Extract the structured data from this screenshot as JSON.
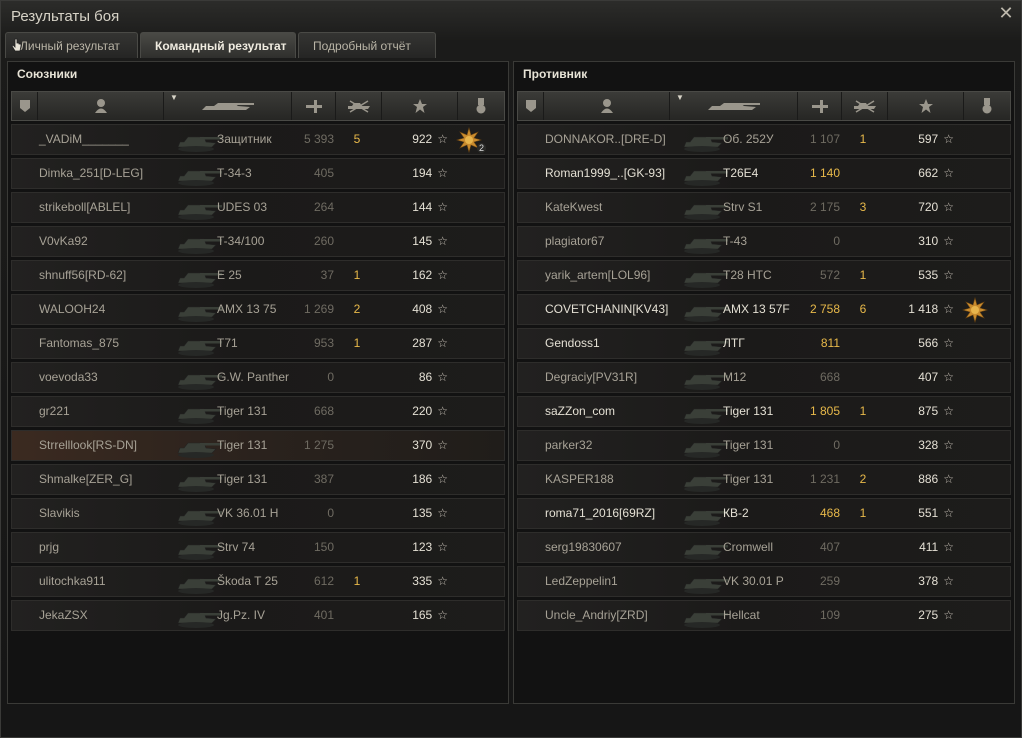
{
  "window": {
    "title": "Результаты боя"
  },
  "tabs": [
    {
      "label": "Личный результат",
      "active": false
    },
    {
      "label": "Командный результат",
      "active": true
    },
    {
      "label": "Подробный отчёт",
      "active": false
    }
  ],
  "allies": {
    "title": "Союзники",
    "players": [
      {
        "name": "_VADiM_______",
        "vehicle": "Защитник",
        "damage": "5 393",
        "kills": "5",
        "xp": "922",
        "alive": false,
        "damage_highlight": false,
        "medal": "hero-medal",
        "medal_count": "2",
        "highlight": false
      },
      {
        "name": "Dimka_251[D-LEG]",
        "vehicle": "T-34-3",
        "damage": "405",
        "kills": "",
        "xp": "194",
        "alive": false,
        "damage_highlight": false,
        "highlight": false
      },
      {
        "name": "strikeboll[ABLEL]",
        "vehicle": "UDES 03",
        "damage": "264",
        "kills": "",
        "xp": "144",
        "alive": false,
        "damage_highlight": false,
        "highlight": false
      },
      {
        "name": "V0vKa92",
        "vehicle": "T-34/100",
        "damage": "260",
        "kills": "",
        "xp": "145",
        "alive": false,
        "damage_highlight": false,
        "highlight": false
      },
      {
        "name": "shnuff56[RD-62]",
        "vehicle": "E 25",
        "damage": "37",
        "kills": "1",
        "xp": "162",
        "alive": false,
        "damage_highlight": false,
        "highlight": false
      },
      {
        "name": "WALOOH24",
        "vehicle": "AMX 13 75",
        "damage": "1 269",
        "kills": "2",
        "xp": "408",
        "alive": false,
        "damage_highlight": false,
        "highlight": false
      },
      {
        "name": "Fantomas_875",
        "vehicle": "T71",
        "damage": "953",
        "kills": "1",
        "xp": "287",
        "alive": false,
        "damage_highlight": false,
        "highlight": false
      },
      {
        "name": "voevoda33",
        "vehicle": "G.W. Panther",
        "damage": "0",
        "kills": "",
        "xp": "86",
        "alive": false,
        "damage_highlight": false,
        "highlight": false
      },
      {
        "name": "gr221",
        "vehicle": "Tiger 131",
        "damage": "668",
        "kills": "",
        "xp": "220",
        "alive": false,
        "damage_highlight": false,
        "highlight": false
      },
      {
        "name": "Strrelllook[RS-DN]",
        "vehicle": "Tiger 131",
        "damage": "1 275",
        "kills": "",
        "xp": "370",
        "alive": false,
        "damage_highlight": false,
        "highlight": true
      },
      {
        "name": "Shmalke[ZER_G]",
        "vehicle": "Tiger 131",
        "damage": "387",
        "kills": "",
        "xp": "186",
        "alive": false,
        "damage_highlight": false,
        "highlight": false
      },
      {
        "name": "Slavikis",
        "vehicle": "VK 36.01 H",
        "damage": "0",
        "kills": "",
        "xp": "135",
        "alive": false,
        "damage_highlight": false,
        "highlight": false
      },
      {
        "name": "prjg",
        "vehicle": "Strv 74",
        "damage": "150",
        "kills": "",
        "xp": "123",
        "alive": false,
        "damage_highlight": false,
        "highlight": false
      },
      {
        "name": "ulitochka911",
        "vehicle": "Škoda T 25",
        "damage": "612",
        "kills": "1",
        "xp": "335",
        "alive": false,
        "damage_highlight": false,
        "highlight": false
      },
      {
        "name": "JekaZSX",
        "vehicle": "Jg.Pz. IV",
        "damage": "401",
        "kills": "",
        "xp": "165",
        "alive": false,
        "damage_highlight": false,
        "highlight": false
      }
    ]
  },
  "enemies": {
    "title": "Противник",
    "players": [
      {
        "name": "DONNAKOR..[DRE-D]",
        "vehicle": "Об. 252У",
        "damage": "1 107",
        "kills": "1",
        "xp": "597",
        "alive": false,
        "damage_highlight": false,
        "highlight": false
      },
      {
        "name": "Roman1999_..[GK-93]",
        "vehicle": "T26E4",
        "damage": "1 140",
        "kills": "",
        "xp": "662",
        "alive": true,
        "damage_highlight": true,
        "highlight": false
      },
      {
        "name": "KateKwest",
        "vehicle": "Strv S1",
        "damage": "2 175",
        "kills": "3",
        "xp": "720",
        "alive": false,
        "damage_highlight": false,
        "highlight": false
      },
      {
        "name": "plagiator67",
        "vehicle": "T-43",
        "damage": "0",
        "kills": "",
        "xp": "310",
        "alive": false,
        "damage_highlight": false,
        "highlight": false
      },
      {
        "name": "yarik_artem[LOL96]",
        "vehicle": "T28 HTC",
        "damage": "572",
        "kills": "1",
        "xp": "535",
        "alive": false,
        "damage_highlight": false,
        "highlight": false
      },
      {
        "name": "COVETCHANIN[KV43]",
        "vehicle": "AMX 13 57F",
        "damage": "2 758",
        "kills": "6",
        "xp": "1 418",
        "alive": true,
        "damage_highlight": true,
        "medal": "hero-medal",
        "highlight": false
      },
      {
        "name": "Gendoss1",
        "vehicle": "ЛТГ",
        "damage": "811",
        "kills": "",
        "xp": "566",
        "alive": true,
        "damage_highlight": true,
        "highlight": false
      },
      {
        "name": "Degraciy[PV31R]",
        "vehicle": "M12",
        "damage": "668",
        "kills": "",
        "xp": "407",
        "alive": false,
        "damage_highlight": false,
        "highlight": false
      },
      {
        "name": "saZZon_com",
        "vehicle": "Tiger 131",
        "damage": "1 805",
        "kills": "1",
        "xp": "875",
        "alive": true,
        "damage_highlight": true,
        "highlight": false
      },
      {
        "name": "parker32",
        "vehicle": "Tiger 131",
        "damage": "0",
        "kills": "",
        "xp": "328",
        "alive": false,
        "damage_highlight": false,
        "highlight": false
      },
      {
        "name": "KASPER188",
        "vehicle": "Tiger 131",
        "damage": "1 231",
        "kills": "2",
        "xp": "886",
        "alive": false,
        "damage_highlight": false,
        "highlight": false
      },
      {
        "name": "roma71_2016[69RZ]",
        "vehicle": "КВ-2",
        "damage": "468",
        "kills": "1",
        "xp": "551",
        "alive": true,
        "damage_highlight": true,
        "highlight": false
      },
      {
        "name": "serg19830607",
        "vehicle": "Cromwell",
        "damage": "407",
        "kills": "",
        "xp": "411",
        "alive": false,
        "damage_highlight": false,
        "highlight": false
      },
      {
        "name": "LedZeppelin1",
        "vehicle": "VK 30.01 P",
        "damage": "259",
        "kills": "",
        "xp": "378",
        "alive": false,
        "damage_highlight": false,
        "highlight": false
      },
      {
        "name": "Uncle_Andriy[ZRD]",
        "vehicle": "Hellcat",
        "damage": "109",
        "kills": "",
        "xp": "275",
        "alive": false,
        "damage_highlight": false,
        "highlight": false
      }
    ]
  },
  "columns": [
    "squad-icon",
    "player-icon",
    "vehicle-icon",
    "damage-icon",
    "kills-icon",
    "xp-icon",
    "medal-icon"
  ],
  "colors": {
    "accent": "#e8b94a",
    "alive_text": "#e4e0d4",
    "dead_text": "#a7a296"
  }
}
